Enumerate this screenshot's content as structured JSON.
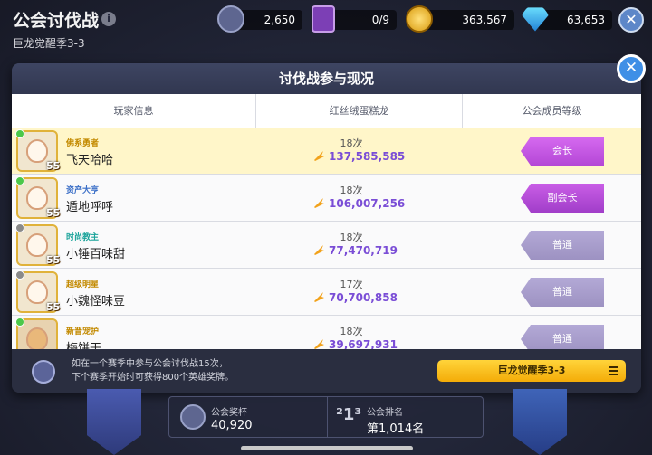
{
  "header": {
    "title": "公会讨伐战",
    "subtitle": "巨龙觉醒季3-3",
    "resources": [
      {
        "icon": "trophy-shield-icon",
        "value": "2,650"
      },
      {
        "icon": "ticket-card-icon",
        "value": "0/9"
      },
      {
        "icon": "coin-icon",
        "value": "363,567"
      },
      {
        "icon": "diamond-icon",
        "value": "63,653"
      }
    ]
  },
  "modal": {
    "title": "讨伐战参与现况",
    "columns": [
      "玩家信息",
      "红丝绒蛋糕龙",
      "公会成员等级"
    ],
    "rows": [
      {
        "badge": "佛系勇者",
        "name": "飞天哈哈",
        "level": "55",
        "count": "18次",
        "damage": "137,585,585",
        "rank": "会长",
        "online": true,
        "me": true
      },
      {
        "badge": "资产大亨",
        "name": "遁地呼呼",
        "level": "55",
        "count": "18次",
        "damage": "106,007,256",
        "rank": "副会长",
        "online": true,
        "me": false
      },
      {
        "badge": "时尚教主",
        "name": "小锤百味甜",
        "level": "55",
        "count": "18次",
        "damage": "77,470,719",
        "rank": "普通",
        "online": false,
        "me": false
      },
      {
        "badge": "超级明星",
        "name": "小魏怪味豆",
        "level": "55",
        "count": "17次",
        "damage": "70,700,858",
        "rank": "普通",
        "online": false,
        "me": false
      },
      {
        "badge": "新晋宠护",
        "name": "梅饼干",
        "level": "",
        "count": "18次",
        "damage": "39,697,931",
        "rank": "普通",
        "online": true,
        "me": false
      }
    ],
    "footer": {
      "text_line1": "如在一个赛季中参与公会讨伐战15次，",
      "text_line2": "下个赛季开始时可获得800个英雄奖牌。",
      "season_button": "巨龙觉醒季3-3"
    }
  },
  "stats": {
    "trophy_label": "公会奖杯",
    "trophy_value": "40,920",
    "rank_label": "公会排名",
    "rank_value": "第1,014名"
  },
  "colors": {
    "leader": "#c25be0",
    "vice_leader": "#b04fd4",
    "normal": "#a79dc9",
    "damage": "#7a4dd6",
    "online": "#4cc84a",
    "offline": "#8a8a8a"
  }
}
